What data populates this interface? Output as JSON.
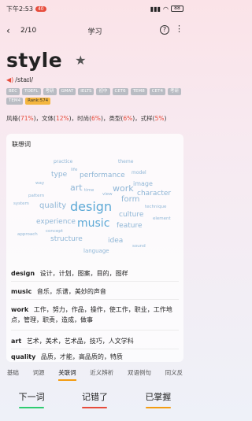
{
  "status_bar": {
    "time": "下午2:53",
    "badge": "40",
    "battery": "88"
  },
  "nav": {
    "back_icon": "chevron-left",
    "counter": "2/10",
    "title": "学习",
    "help_icon": "?",
    "more_icon": "⋮"
  },
  "word": {
    "text": "style",
    "phonetic": "/staɪl/"
  },
  "tags": [
    "BEC",
    "TOEFL",
    "考研",
    "GMAT",
    "IELTS",
    "初中",
    "CET6",
    "TEM8",
    "CET4",
    "考研",
    "TEM4",
    "Rank:574"
  ],
  "freq": {
    "fengge_label": "风格(",
    "fengge_pct": "71%",
    "fengge_end": ")，",
    "wenti_label": "文体(",
    "wenti_pct": "12%",
    "wenti_end": ")，",
    "shishang_label": "时尚(",
    "shishang_pct": "6%",
    "shishang_end": ")，",
    "leixing_label": "类型(",
    "leixing_pct": "6%",
    "leixing_end": ")，",
    "shiyang_label": "式样(",
    "shiyang_pct": "5%",
    "shiyang_end": ")"
  },
  "card": {
    "title": "联想词",
    "cloud": [
      "practice",
      "theme",
      "life",
      "type",
      "performance",
      "model",
      "way",
      "image",
      "art",
      "time",
      "work",
      "character",
      "pattern",
      "view",
      "form",
      "system",
      "quality",
      "design",
      "technique",
      "culture",
      "experience",
      "music",
      "element",
      "feature",
      "concept",
      "approach",
      "structure",
      "idea",
      "sound",
      "language"
    ],
    "assoc": [
      {
        "word": "design",
        "meaning": "设计，计划，图案，目的，图样"
      },
      {
        "word": "music",
        "meaning": "音乐，乐谱，美妙的声音"
      },
      {
        "word": "work",
        "meaning": "工作，努力，作品，操作，使工作，职业，工作地点，管理，职责，造成，做事"
      },
      {
        "word": "art",
        "meaning": "艺术，美术，艺术品，技巧，人文学科"
      },
      {
        "word": "quality",
        "meaning": "品质，才能，高品质的，特质"
      }
    ]
  },
  "tabs": [
    "基础",
    "词源",
    "关联词",
    "近义辨析",
    "双语例句",
    "同义反"
  ],
  "buttons": {
    "next": "下一词",
    "wrong": "记错了",
    "mastered": "已掌握"
  },
  "colors": {
    "accent": "#e74c3c",
    "next_bar": "#2ecc71",
    "wrong_bar": "#e74c3c",
    "mastered_bar": "#f39c12"
  }
}
